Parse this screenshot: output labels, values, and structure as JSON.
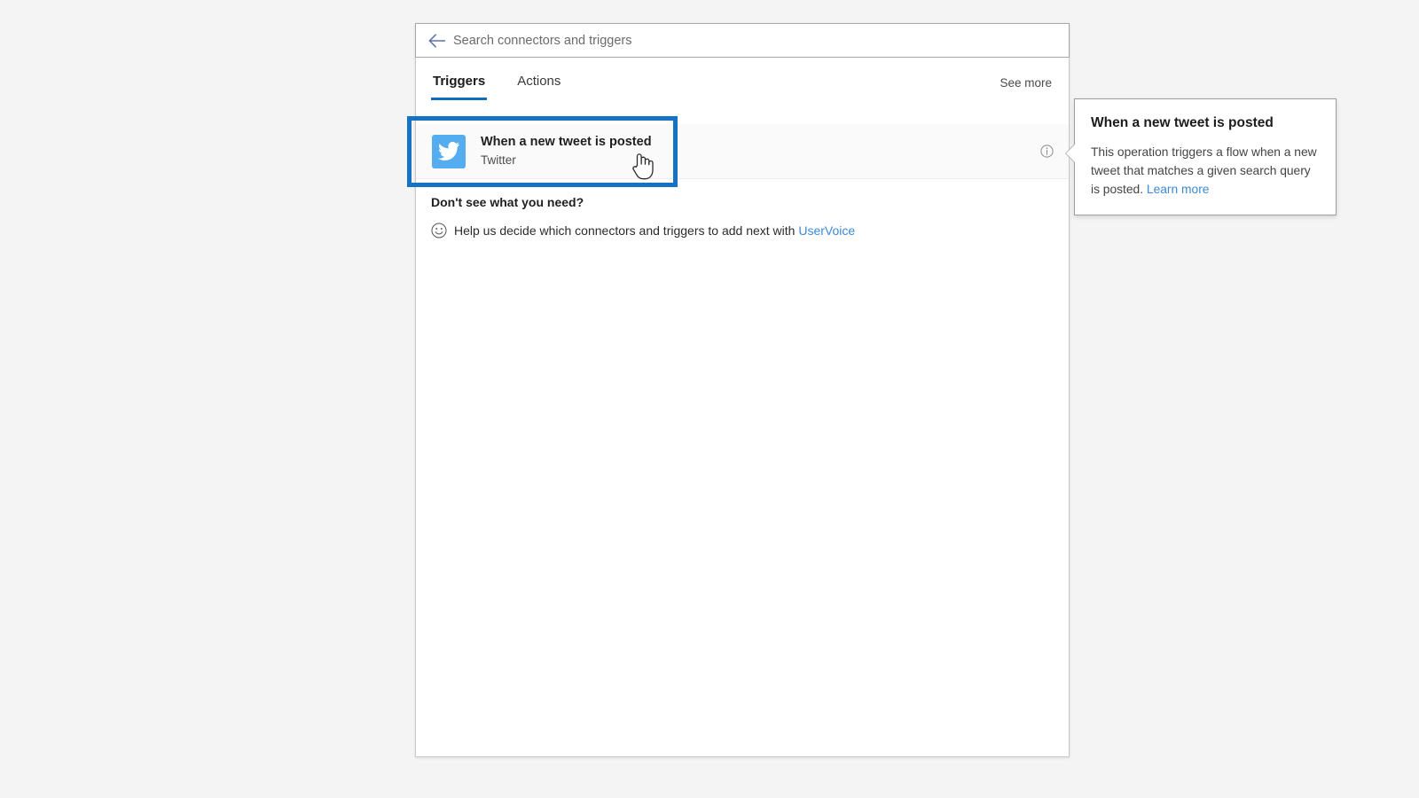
{
  "search": {
    "placeholder": "Search connectors and triggers",
    "value": "",
    "back_icon": "back-arrow-icon"
  },
  "tabs": {
    "items": [
      {
        "label": "Triggers",
        "selected": true
      },
      {
        "label": "Actions",
        "selected": false
      }
    ],
    "see_more_label": "See more"
  },
  "results": [
    {
      "title": "When a new tweet is posted",
      "subtitle": "Twitter",
      "icon": "twitter-icon",
      "info_icon": "info-icon"
    }
  ],
  "help": {
    "heading": "Don't see what you need?",
    "icon": "smiley-icon",
    "text_before": "Help us decide which connectors and triggers to add next with",
    "link_label": "UserVoice"
  },
  "tooltip": {
    "title": "When a new tweet is posted",
    "body": "This operation triggers a flow when a new tweet that matches a given search query is posted.",
    "link_label": "Learn more"
  },
  "colors": {
    "accent_blue": "#0f6cbd",
    "highlight_blue": "#1673c4",
    "twitter_blue": "#55acee",
    "link_blue": "#3b8ad8",
    "page_background": "#f4f4f4",
    "panel_background": "#ffffff"
  },
  "cursor": {
    "type": "pointer-hand-cursor"
  }
}
